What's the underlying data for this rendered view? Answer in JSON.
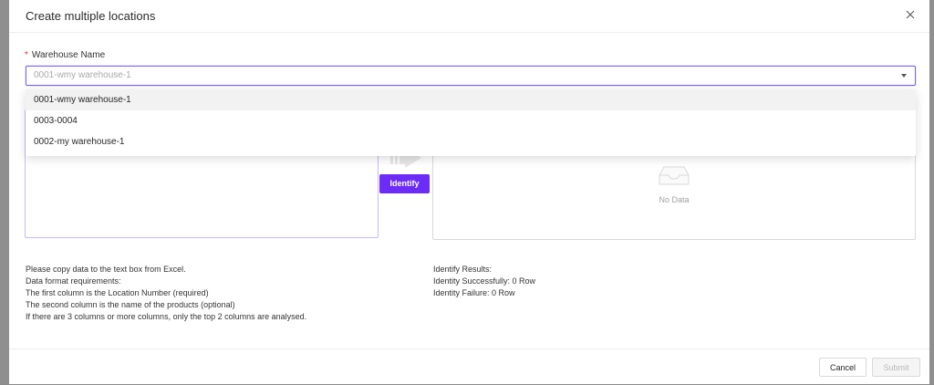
{
  "modal": {
    "title": "Create multiple locations",
    "close_label": "X"
  },
  "warehouse_field": {
    "required_mark": "*",
    "label": "Warehouse Name",
    "value": "0001-wmy warehouse-1"
  },
  "dropdown": {
    "options": [
      {
        "label": "0001-wmy warehouse-1",
        "selected": true
      },
      {
        "label": "0003-0004",
        "selected": false
      },
      {
        "label": "0002-my warehouse-1",
        "selected": false
      }
    ]
  },
  "identify_button": {
    "label": "Identify"
  },
  "results_panel": {
    "empty_text": "No Data"
  },
  "instructions": {
    "lines": [
      "Please copy data to the text box from Excel.",
      "Data format requirements:",
      "The first column is the Location Number (required)",
      "The second column is the name of the products (optional)",
      "If there are 3 columns or more columns, only the top 2 columns are analysed."
    ]
  },
  "results": {
    "lines": [
      "Identify Results:",
      "Identity Successfully: 0 Row",
      "Identity Failure: 0 Row"
    ]
  },
  "footer": {
    "cancel_label": "Cancel",
    "submit_label": "Submit"
  },
  "colors": {
    "accent": "#6c2bf7",
    "focus_border": "#7b61ff",
    "required": "#f5222d"
  },
  "icons": {
    "close": "close-icon",
    "dropdown": "chevron-down-icon",
    "empty": "empty-inbox-icon",
    "transfer": "arrow-right-icon"
  }
}
